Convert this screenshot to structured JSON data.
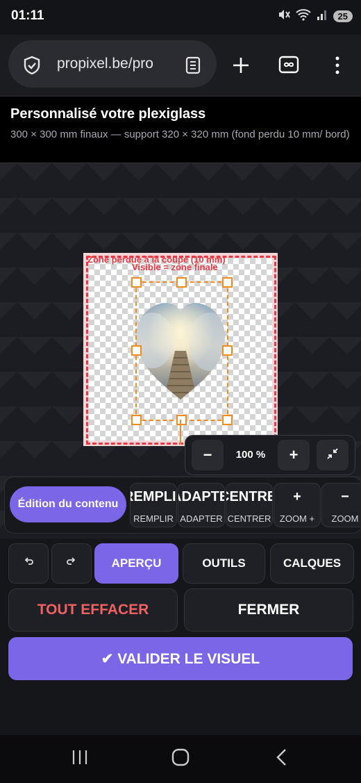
{
  "status_bar": {
    "time": "01:11",
    "battery": "25",
    "network": "6E"
  },
  "browser": {
    "url": "propixel.be/pro"
  },
  "header": {
    "title": "Personnalisé votre plexiglass",
    "subtitle": "300 × 300 mm finaux — support 320 × 320 mm (fond perdu 10 mm/ bord)"
  },
  "canvas": {
    "bleed_label": "Zone perdue à la coupe (10 mm)",
    "safe_label": "Visible = zone finale"
  },
  "zoom": {
    "minus": "−",
    "value": "100 %",
    "plus": "+"
  },
  "toolbar": {
    "edit_label": "Édition du contenu",
    "tools": [
      {
        "big": "REMPLIR",
        "small": "REMPLIR"
      },
      {
        "big": "ADAPTER",
        "small": "ADAPTER"
      },
      {
        "big": "CENTRER",
        "small": "CENTRER"
      },
      {
        "big": "+",
        "small": "ZOOM +"
      },
      {
        "big": "−",
        "small": "ZOOM"
      }
    ]
  },
  "actions": {
    "tabs": [
      "APERÇU",
      "OUTILS",
      "CALQUES"
    ],
    "clear": "TOUT EFFACER",
    "close": "FERMER",
    "validate": "✔ VALIDER LE VISUEL"
  },
  "colors": {
    "accent": "#7a66e6",
    "danger": "#f06262",
    "bleed": "#e53945",
    "selection": "#f08c1e"
  }
}
